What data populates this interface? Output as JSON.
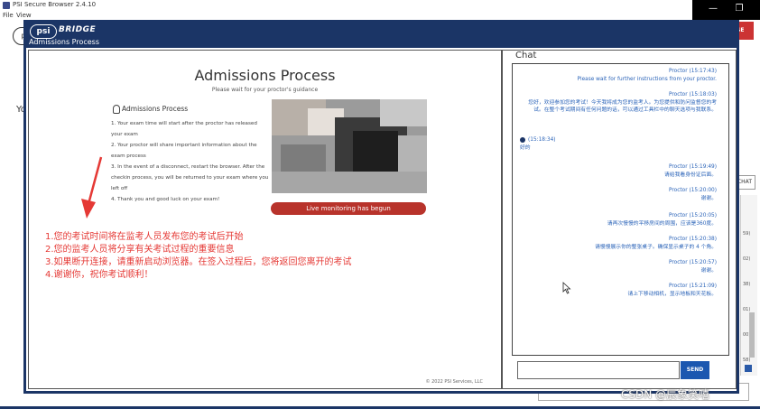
{
  "app": {
    "window_title": "PSI Secure Browser 2.4.10",
    "menu": [
      "File",
      "View"
    ]
  },
  "background": {
    "close_button": "OSE",
    "text_left": "Yo",
    "text_right": "r",
    "chat_button": "CHAT",
    "side_numbers": [
      "59)",
      "02)",
      "38)",
      "01)",
      "00)",
      "58)"
    ]
  },
  "modal": {
    "brand_logo": "psi",
    "brand_name": "BRIDGE",
    "header_title": "Admissions Process",
    "page_title": "Admissions Process",
    "page_subtitle": "Please wait for your proctor's guidance",
    "section_heading": "Admissions Process",
    "instructions": [
      "1. Your exam time will start after the proctor has released your exam",
      "2. Your proctor will share important information about the exam process",
      "3. In the event of a disconnect, restart the browser. After the checkin process, you will be returned to your exam where you left off",
      "4. Thank you and good luck on your exam!"
    ],
    "live_monitoring": "Live monitoring has begun",
    "copyright": "© 2022 PSI Services, LLC"
  },
  "chat": {
    "title": "Chat",
    "send_label": "SEND",
    "messages": [
      {
        "sender": "Proctor",
        "time": "(15:17:43)",
        "text": "Please wait for further instructions from your proctor.",
        "side": "right"
      },
      {
        "sender": "Proctor",
        "time": "(15:18:03)",
        "text": "您好，欢迎参加您的考试！今天我将成为您的监考人。为您提供和防问监督您的考试。在整个考试期间有任何问题的话，可以通过工具栏中的聊天选项与我联系。",
        "side": "right"
      },
      {
        "sender": "",
        "time": "(15:18:34)",
        "text": "好的",
        "side": "left"
      },
      {
        "sender": "Proctor",
        "time": "(15:19:49)",
        "text": "请给我看身份证后面。",
        "side": "right"
      },
      {
        "sender": "Proctor",
        "time": "(15:20:00)",
        "text": "谢谢。",
        "side": "right"
      },
      {
        "sender": "Proctor",
        "time": "(15:20:05)",
        "text": "请再次慢慢的平移房间的周围，应该是360度。",
        "side": "right"
      },
      {
        "sender": "Proctor",
        "time": "(15:20:38)",
        "text": "请慢慢展示你的整张桌子。确保显示桌子的 4 个角。",
        "side": "right"
      },
      {
        "sender": "Proctor",
        "time": "(15:20:57)",
        "text": "谢谢。",
        "side": "right"
      },
      {
        "sender": "Proctor",
        "time": "(15:21:09)",
        "text": "请上下移动相机，显示地板和天花板。",
        "side": "right"
      }
    ]
  },
  "annotation": {
    "lines": [
      "1.您的考试时间将在监考人员发布您的考试后开始",
      "2.您的监考人员将分享有关考试过程的重要信息",
      "3.如果断开连接，请重新启动浏览器。在签入过程后，您将返回您离开的考试",
      "4.谢谢你，祝你考试顺利！"
    ],
    "color": "#e53935"
  },
  "watermark": "CSDN @辰象笑嘻"
}
